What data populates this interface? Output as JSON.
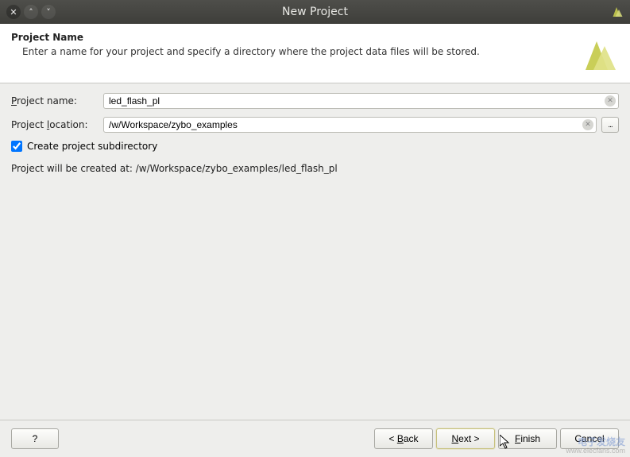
{
  "window": {
    "title": "New Project"
  },
  "banner": {
    "heading": "Project Name",
    "description": "Enter a name for your project and specify a directory where the project data files will be stored."
  },
  "form": {
    "name_label_pre": "P",
    "name_label_post": "roject name:",
    "name_value": "led_flash_pl",
    "location_label_pre": "Project ",
    "location_label_mn": "l",
    "location_label_post": "ocation:",
    "location_value": "/w/Workspace/zybo_examples",
    "browse_label": "...",
    "checkbox_label": "Create project subdirectory",
    "checkbox_checked": true,
    "created_at_prefix": "Project will be created at: ",
    "created_at_path": "/w/Workspace/zybo_examples/led_flash_pl"
  },
  "buttons": {
    "help": "?",
    "back_pre": "< ",
    "back_mn": "B",
    "back_post": "ack",
    "next_mn": "N",
    "next_post": "ext >",
    "finish_mn": "F",
    "finish_post": "inish",
    "cancel": "Cancel"
  },
  "watermark": {
    "line1": "电子发烧友",
    "line2": "www.elecfans.com"
  }
}
